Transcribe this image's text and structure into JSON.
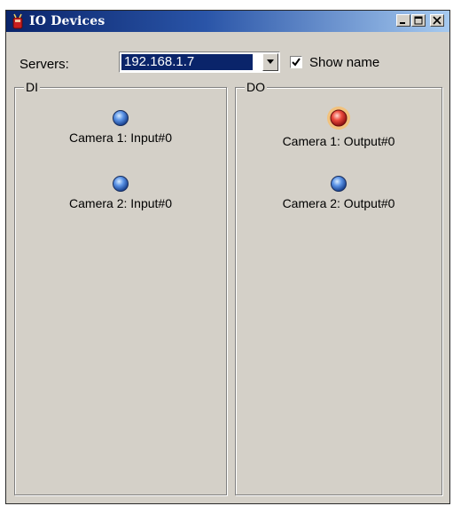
{
  "window": {
    "title": "IO Devices",
    "icon": "io-device-icon"
  },
  "servers": {
    "label": "Servers:",
    "selected": "192.168.1.7"
  },
  "show_name": {
    "label": "Show name",
    "checked": true
  },
  "di": {
    "title": "DI",
    "items": [
      {
        "label": "Camera 1: Input#0",
        "state": "off",
        "color": "#2f6bd1"
      },
      {
        "label": "Camera 2: Input#0",
        "state": "off",
        "color": "#2f6bd1"
      }
    ]
  },
  "do": {
    "title": "DO",
    "items": [
      {
        "label": "Camera 1: Output#0",
        "state": "on",
        "color": "#e03030"
      },
      {
        "label": "Camera 2: Output#0",
        "state": "off",
        "color": "#2f6bd1"
      }
    ]
  },
  "colors": {
    "titlebar_start": "#0a246a",
    "titlebar_end": "#a6caf0",
    "window_bg": "#d4d0c8",
    "led_off": "#2f6bd1",
    "led_on": "#e03030"
  }
}
